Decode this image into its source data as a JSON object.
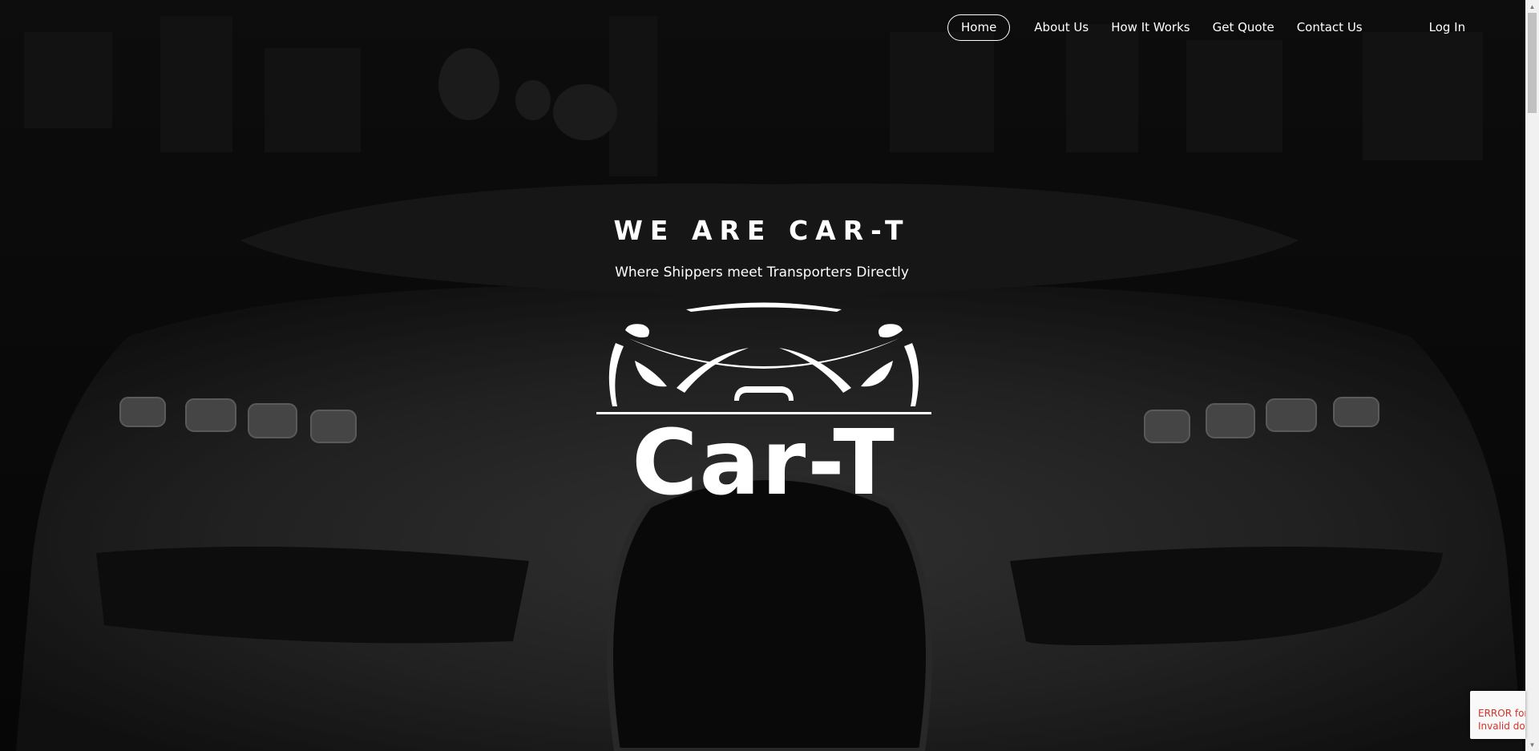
{
  "nav": {
    "home": "Home",
    "about": "About Us",
    "how_it_works": "How It Works",
    "get_quote": "Get Quote",
    "contact": "Contact Us",
    "login": "Log In"
  },
  "hero": {
    "title": "WE ARE CAR-T",
    "subtitle": "Where Shippers meet Transporters Directly",
    "logo_text": "Car-T"
  },
  "recaptcha_error": {
    "line1": "ERROR for",
    "line2": "Invalid do"
  },
  "colors": {
    "text": "#ffffff",
    "background": "#0b0b0b",
    "error": "#d93025"
  }
}
